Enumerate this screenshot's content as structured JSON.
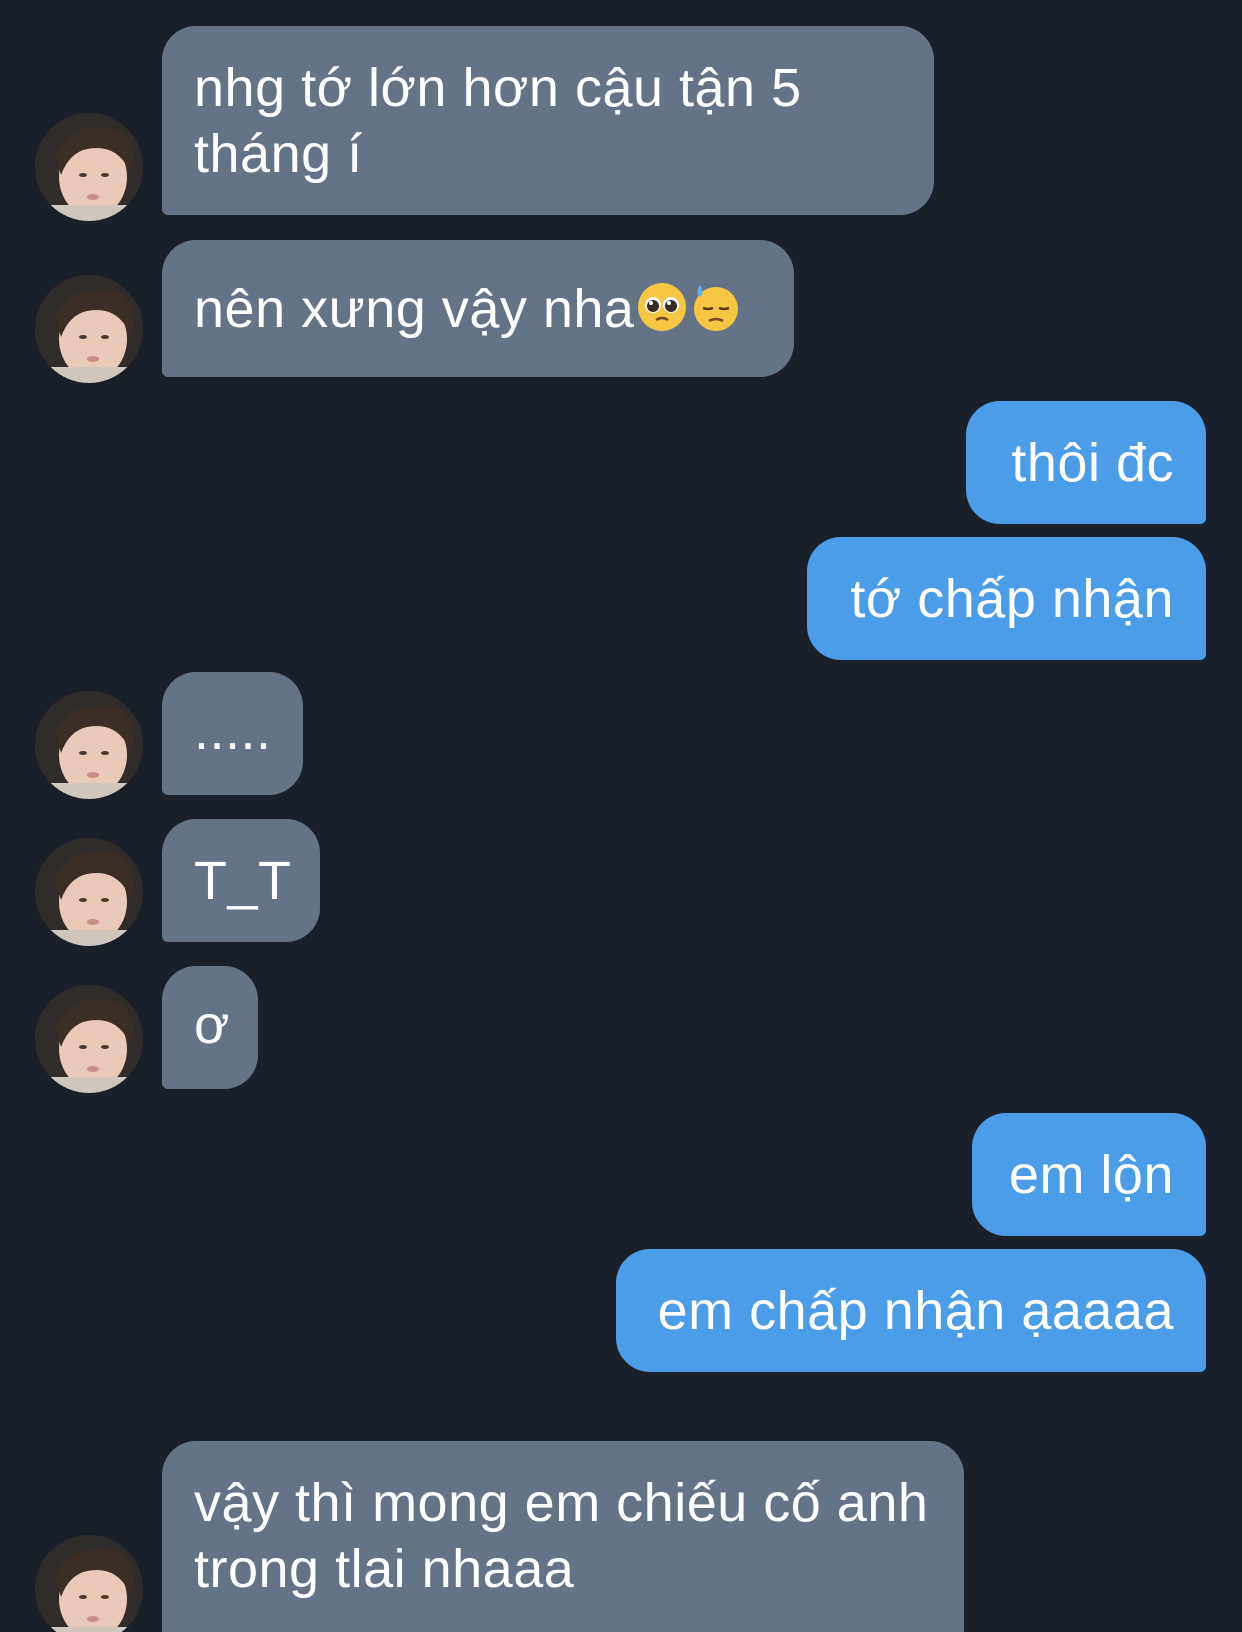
{
  "colors": {
    "background": "#1a202a",
    "incoming_bubble": "#657386",
    "outgoing_bubble": "#4b9de8",
    "text": "#ffffff"
  },
  "contact": {
    "avatar_icon": "profile-photo-avatar"
  },
  "messages": [
    {
      "direction": "incoming",
      "text": "nhg tớ lớn hơn cậu tận 5 tháng í",
      "avatar": true
    },
    {
      "direction": "incoming",
      "text": "nên xưng vậy nha",
      "emojis": [
        "pleading-face-emoji",
        "downcast-face-with-sweat-emoji"
      ],
      "avatar": true
    },
    {
      "direction": "outgoing",
      "text": "thôi đc"
    },
    {
      "direction": "outgoing",
      "text": "tớ chấp nhận"
    },
    {
      "direction": "incoming",
      "text": ".....",
      "avatar": true
    },
    {
      "direction": "incoming",
      "text": "T_T",
      "avatar": true
    },
    {
      "direction": "incoming",
      "text": "ơ",
      "avatar": true
    },
    {
      "direction": "outgoing",
      "text": "em lộn"
    },
    {
      "direction": "outgoing",
      "text": "em chấp nhận ạaaaa"
    },
    {
      "direction": "incoming",
      "text": "vậy thì mong em chiếu cố anh trong tlai nhaaa",
      "avatar": true
    }
  ]
}
